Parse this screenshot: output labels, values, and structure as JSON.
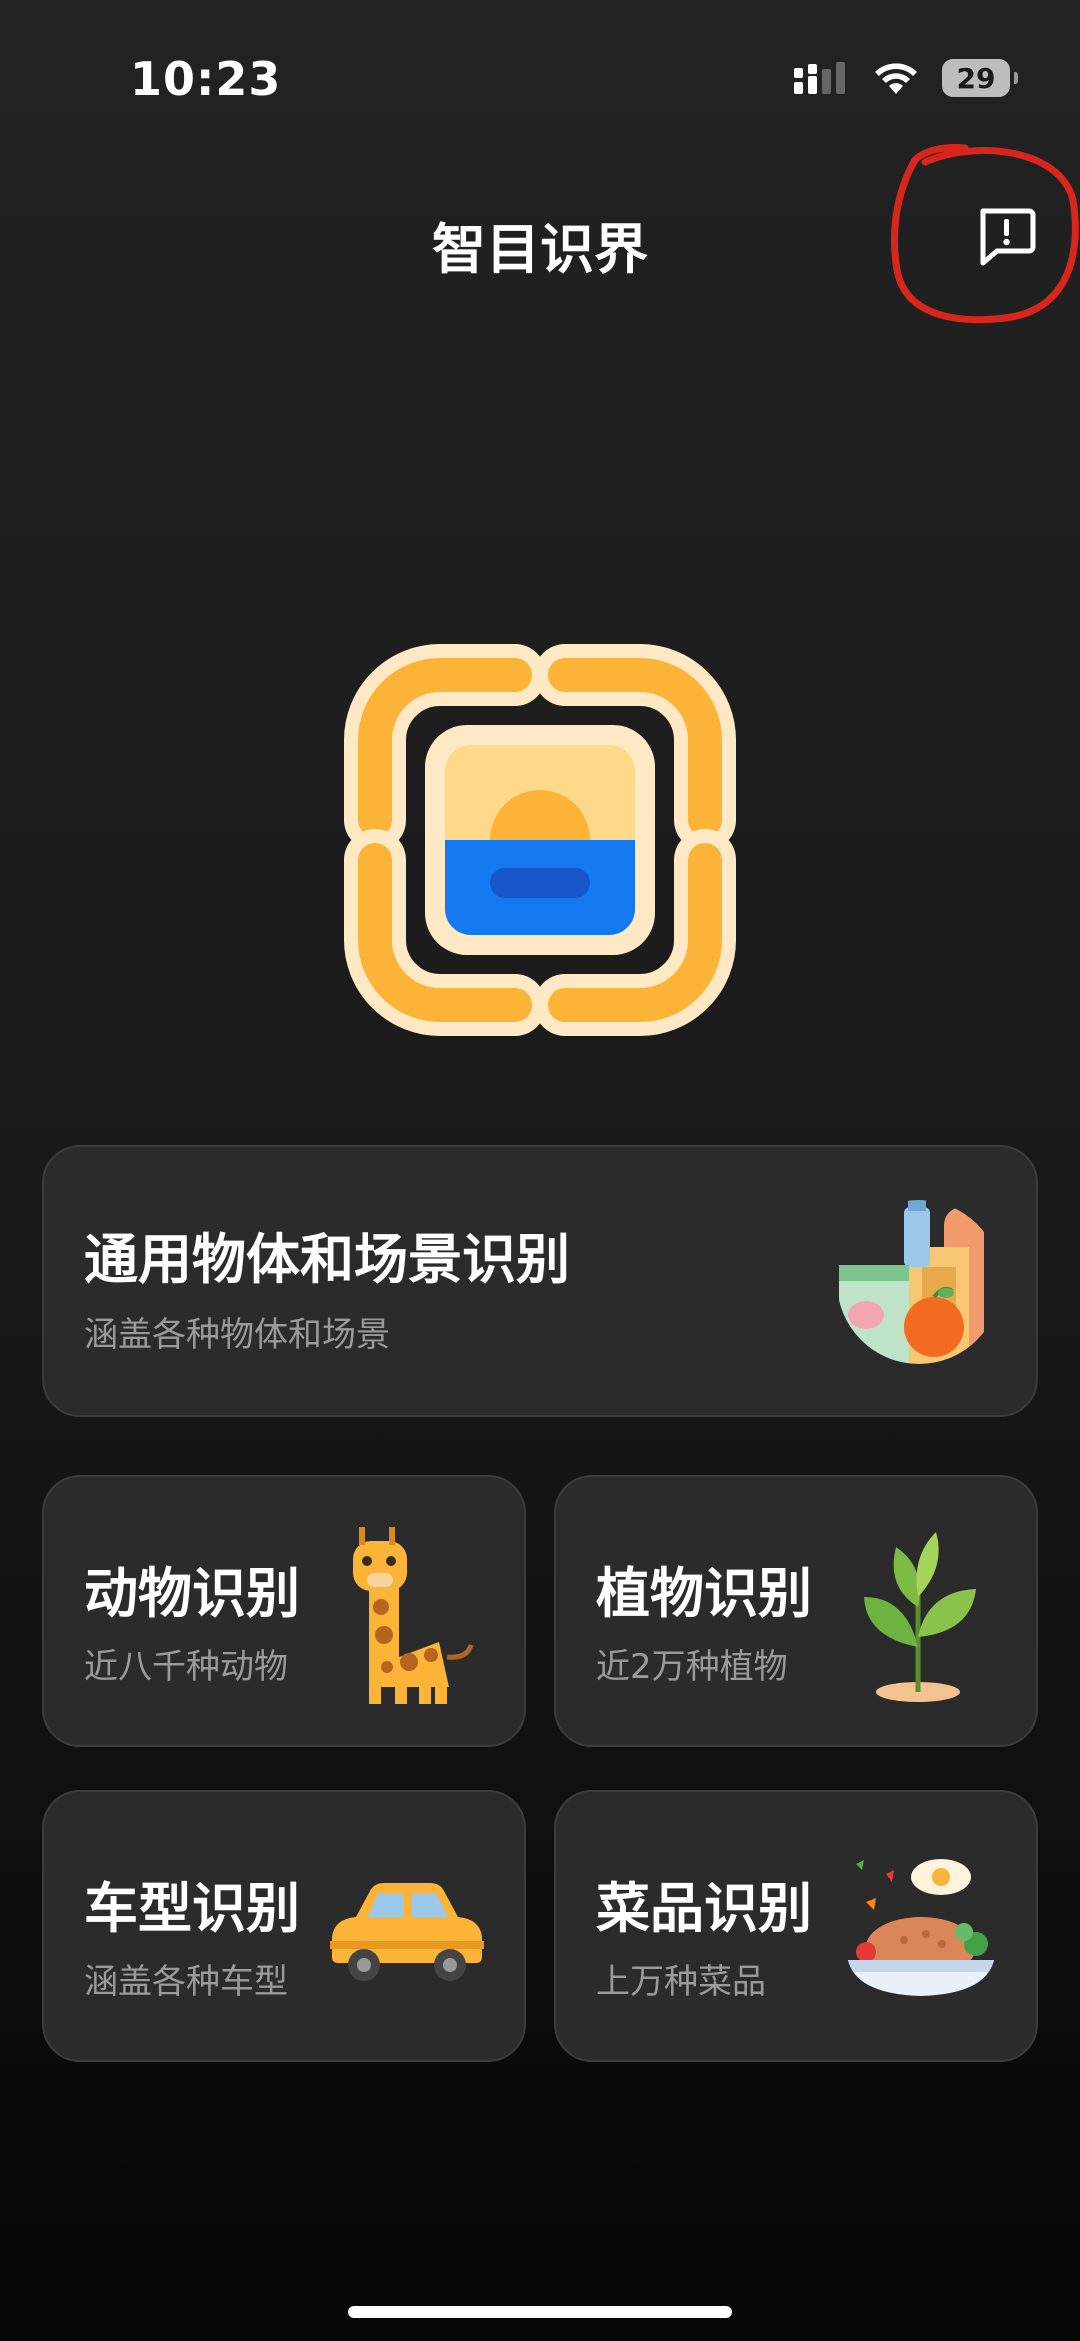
{
  "status_bar": {
    "time": "10:23",
    "battery_level": "29"
  },
  "header": {
    "title": "智目识界",
    "feedback_icon": "message-alert-icon"
  },
  "logo": {
    "icon": "scan-frame-sunrise-icon"
  },
  "cards": {
    "general": {
      "title": "通用物体和场景识别",
      "subtitle": "涵盖各种物体和场景",
      "icon": "groceries-icon"
    },
    "animal": {
      "title": "动物识别",
      "subtitle": "近八千种动物",
      "icon": "giraffe-icon"
    },
    "plant": {
      "title": "植物识别",
      "subtitle": "近2万种植物",
      "icon": "plant-icon"
    },
    "car": {
      "title": "车型识别",
      "subtitle": "涵盖各种车型",
      "icon": "car-icon"
    },
    "dish": {
      "title": "菜品识别",
      "subtitle": "上万种菜品",
      "icon": "food-bowl-icon"
    }
  },
  "colors": {
    "accent_orange": "#FBB437",
    "cream": "#FFE9C4",
    "blue": "#1479EE",
    "card_bg": "#2B2B2B",
    "annotation_red": "#D8261C"
  }
}
